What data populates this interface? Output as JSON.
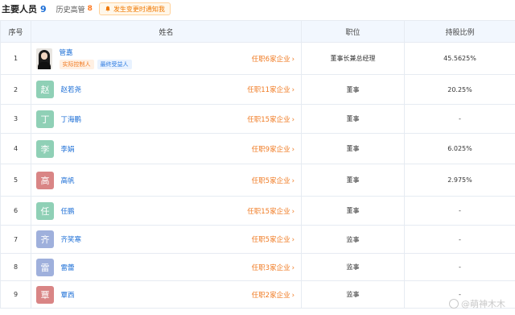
{
  "header": {
    "title": "主要人员",
    "title_count": "9",
    "history_label": "历史高管",
    "history_count": "8",
    "notify_label": "发生变更时通知我"
  },
  "columns": [
    "序号",
    "姓名",
    "职位",
    "持股比例"
  ],
  "rows": [
    {
      "index": "1",
      "avatar": "photo",
      "name": "管嘉",
      "tags": [
        "实际控制人",
        "最终受益人"
      ],
      "position_link": "任职6家企业",
      "role": "董事长兼总经理",
      "share": "45.5625%"
    },
    {
      "index": "2",
      "avatar": "赵",
      "avatar_color": "#8fd0b6",
      "name": "赵若尧",
      "position_link": "任职11家企业",
      "role": "董事",
      "share": "20.25%"
    },
    {
      "index": "3",
      "avatar": "丁",
      "avatar_color": "#8fd0b6",
      "name": "丁海鹏",
      "position_link": "任职15家企业",
      "role": "董事",
      "share": "-"
    },
    {
      "index": "4",
      "avatar": "李",
      "avatar_color": "#8fd0b6",
      "name": "李娟",
      "position_link": "任职9家企业",
      "role": "董事",
      "share": "6.025%"
    },
    {
      "index": "5",
      "avatar": "高",
      "avatar_color": "#d98585",
      "name": "高帆",
      "position_link": "任职5家企业",
      "role": "董事",
      "share": "2.975%"
    },
    {
      "index": "6",
      "avatar": "任",
      "avatar_color": "#8fd0b6",
      "name": "任鹏",
      "position_link": "任职15家企业",
      "role": "董事",
      "share": "-"
    },
    {
      "index": "7",
      "avatar": "齐",
      "avatar_color": "#9fb0dc",
      "name": "齐笑寒",
      "position_link": "任职5家企业",
      "role": "监事",
      "share": "-"
    },
    {
      "index": "8",
      "avatar": "雷",
      "avatar_color": "#9fb0dc",
      "name": "雷蕾",
      "position_link": "任职3家企业",
      "role": "监事",
      "share": "-"
    },
    {
      "index": "9",
      "avatar": "覃",
      "avatar_color": "#d98585",
      "name": "覃西",
      "position_link": "任职2家企业",
      "role": "监事",
      "share": "-"
    }
  ],
  "watermark": "@萌神木木",
  "colors": {
    "accent_blue": "#1a6dd6",
    "accent_orange": "#f07a22",
    "header_bg": "#f2f7fe"
  }
}
